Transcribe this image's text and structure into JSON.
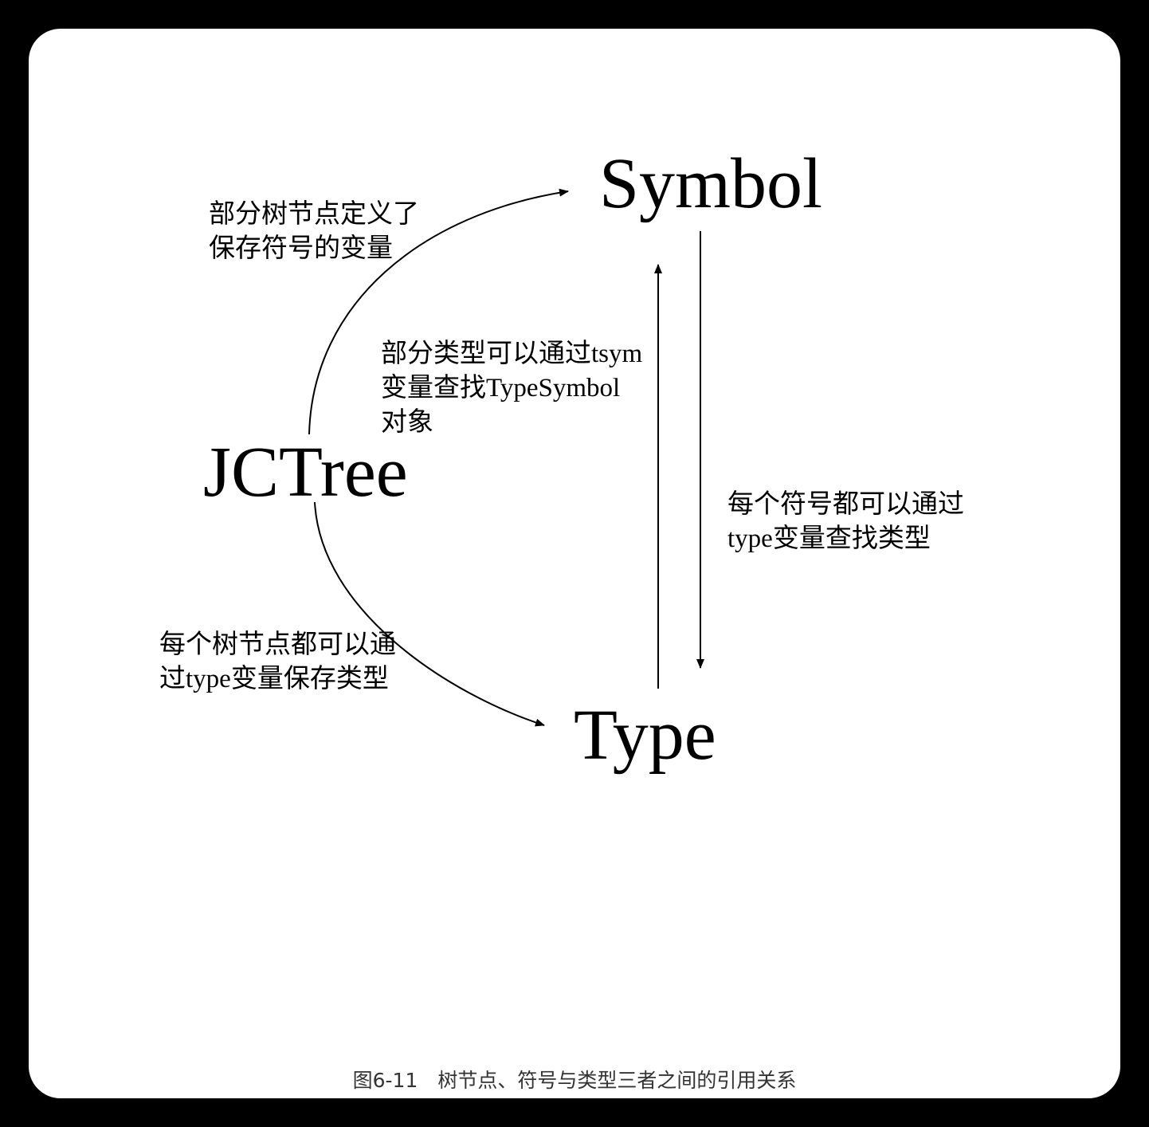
{
  "nodes": {
    "symbol": "Symbol",
    "jctree": "JCTree",
    "type": "Type"
  },
  "labels": {
    "tree_to_symbol": [
      "部分树节点定义了",
      "保存符号的变量"
    ],
    "type_to_symbol": [
      "部分类型可以通过tsym",
      "变量查找TypeSymbol",
      "对象"
    ],
    "symbol_to_type": [
      "每个符号都可以通过",
      "type变量查找类型"
    ],
    "tree_to_type": [
      "每个树节点都可以通",
      "过type变量保存类型"
    ]
  },
  "caption": "图6-11　树节点、符号与类型三者之间的引用关系"
}
